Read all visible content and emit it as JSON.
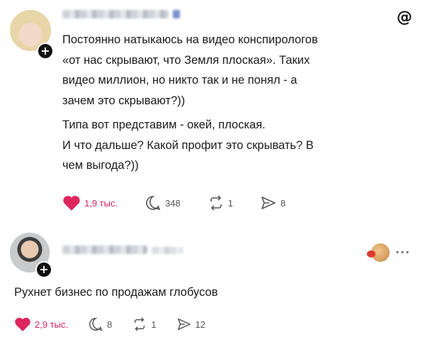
{
  "post1": {
    "author": "",
    "icon": "threads-icon",
    "lines": [
      "Постоянно натыкаюсь на видео конспирологов",
      "«от нас скрывают, что Земля плоская». Таких",
      "видео миллион, но никто так и не понял - а",
      "зачем это скрывают?))",
      "Типа вот представим - окей, плоская.",
      "И что дальше? Какой профит это скрывать? В",
      "чем выгода?))"
    ],
    "likes": "1,9 тыс.",
    "comments": "348",
    "reposts": "1",
    "shares": "8",
    "like_color": "#e0245e"
  },
  "post2": {
    "author": "",
    "text": "Рухнет бизнес по продажам глобусов",
    "more": "···",
    "likes": "2,9 тыс.",
    "comments": "8",
    "reposts": "1",
    "shares": "12",
    "like_color": "#e0245e"
  }
}
